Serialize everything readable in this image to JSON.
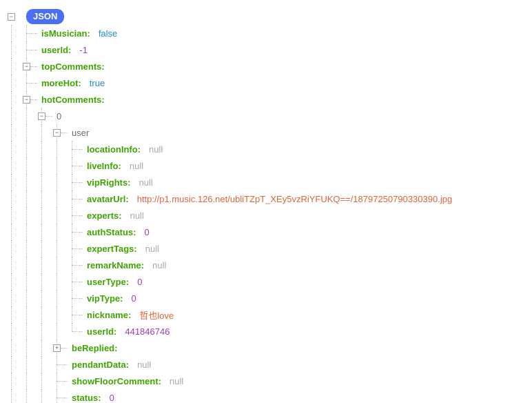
{
  "rootLabel": "JSON",
  "rows": [
    {
      "depth": 0,
      "toggle": "−",
      "badge": true
    },
    {
      "depth": 1,
      "key": "isMusician",
      "colon": true,
      "valType": "bool",
      "val": "false"
    },
    {
      "depth": 1,
      "key": "userId",
      "colon": true,
      "valType": "num",
      "val": "-1"
    },
    {
      "depth": 1,
      "toggle": "−",
      "key": "topComments",
      "colon": true
    },
    {
      "depth": 1,
      "key": "moreHot",
      "colon": true,
      "valType": "bool",
      "val": "true"
    },
    {
      "depth": 1,
      "toggle": "−",
      "key": "hotComments",
      "colon": true
    },
    {
      "depth": 2,
      "toggle": "−",
      "plainkey": "0"
    },
    {
      "depth": 3,
      "toggle": "−",
      "plainkey": "user"
    },
    {
      "depth": 4,
      "key": "locationInfo",
      "colon": true,
      "valType": "null",
      "val": "null"
    },
    {
      "depth": 4,
      "key": "liveInfo",
      "colon": true,
      "valType": "null",
      "val": "null"
    },
    {
      "depth": 4,
      "key": "vipRights",
      "colon": true,
      "valType": "null",
      "val": "null"
    },
    {
      "depth": 4,
      "key": "avatarUrl",
      "colon": true,
      "valType": "str",
      "val": "http://p1.music.126.net/ubliTZpT_XEy5vzRiYFUKQ==/18797250790330390.jpg"
    },
    {
      "depth": 4,
      "key": "experts",
      "colon": true,
      "valType": "null",
      "val": "null"
    },
    {
      "depth": 4,
      "key": "authStatus",
      "colon": true,
      "valType": "num",
      "val": "0"
    },
    {
      "depth": 4,
      "key": "expertTags",
      "colon": true,
      "valType": "null",
      "val": "null"
    },
    {
      "depth": 4,
      "key": "remarkName",
      "colon": true,
      "valType": "null",
      "val": "null"
    },
    {
      "depth": 4,
      "key": "userType",
      "colon": true,
      "valType": "num",
      "val": "0"
    },
    {
      "depth": 4,
      "key": "vipType",
      "colon": true,
      "valType": "num",
      "val": "0"
    },
    {
      "depth": 4,
      "key": "nickname",
      "colon": true,
      "valType": "str",
      "val": "哲也love"
    },
    {
      "depth": 4,
      "key": "userId",
      "colon": true,
      "valType": "num",
      "val": "441846746",
      "lastAtDepth": true
    },
    {
      "depth": 3,
      "toggle": "+",
      "key": "beReplied",
      "colon": true
    },
    {
      "depth": 3,
      "key": "pendantData",
      "colon": true,
      "valType": "null",
      "val": "null"
    },
    {
      "depth": 3,
      "key": "showFloorComment",
      "colon": true,
      "valType": "null",
      "val": "null"
    },
    {
      "depth": 3,
      "key": "status",
      "colon": true,
      "valType": "num",
      "val": "0"
    }
  ],
  "indentPx": 22
}
